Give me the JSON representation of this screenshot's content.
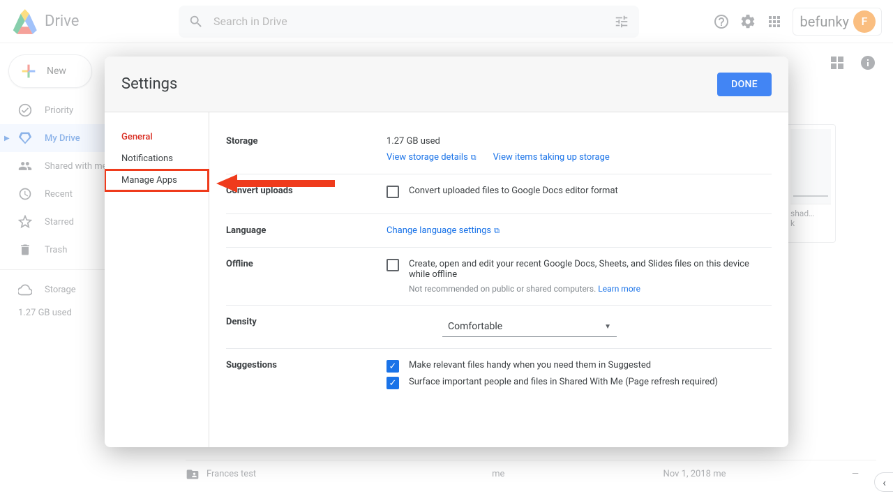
{
  "header": {
    "drive_title": "Drive",
    "search_placeholder": "Search in Drive",
    "befunky_text": "befunky",
    "avatar_initial": "F"
  },
  "sidebar": {
    "new_label": "New",
    "items": [
      {
        "label": "Priority"
      },
      {
        "label": "My Drive"
      },
      {
        "label": "Shared with me"
      },
      {
        "label": "Recent"
      },
      {
        "label": "Starred"
      },
      {
        "label": "Trash"
      }
    ],
    "storage_label": "Storage",
    "storage_used": "1.27 GB used"
  },
  "bg": {
    "row_name": "Frances test",
    "row_owner": "me",
    "row_date": "Nov 1, 2018",
    "row_modifier": "me",
    "row_size": "—",
    "thumb_caption1": "shad…",
    "thumb_caption2": "k"
  },
  "dialog": {
    "title": "Settings",
    "done": "DONE",
    "nav": {
      "general": "General",
      "notifications": "Notifications",
      "manage_apps": "Manage Apps"
    },
    "storage": {
      "label": "Storage",
      "used": "1.27 GB used",
      "details_link": "View storage details",
      "items_link": "View items taking up storage"
    },
    "convert": {
      "label": "Convert uploads",
      "checkbox_text": "Convert uploaded files to Google Docs editor format"
    },
    "language": {
      "label": "Language",
      "link": "Change language settings"
    },
    "offline": {
      "label": "Offline",
      "checkbox_text": "Create, open and edit your recent Google Docs, Sheets, and Slides files on this device while offline",
      "hint": "Not recommended on public or shared computers.",
      "learn_more": "Learn more"
    },
    "density": {
      "label": "Density",
      "value": "Comfortable"
    },
    "suggestions": {
      "label": "Suggestions",
      "opt1": "Make relevant files handy when you need them in Suggested",
      "opt2": "Surface important people and files in Shared With Me (Page refresh required)"
    }
  }
}
